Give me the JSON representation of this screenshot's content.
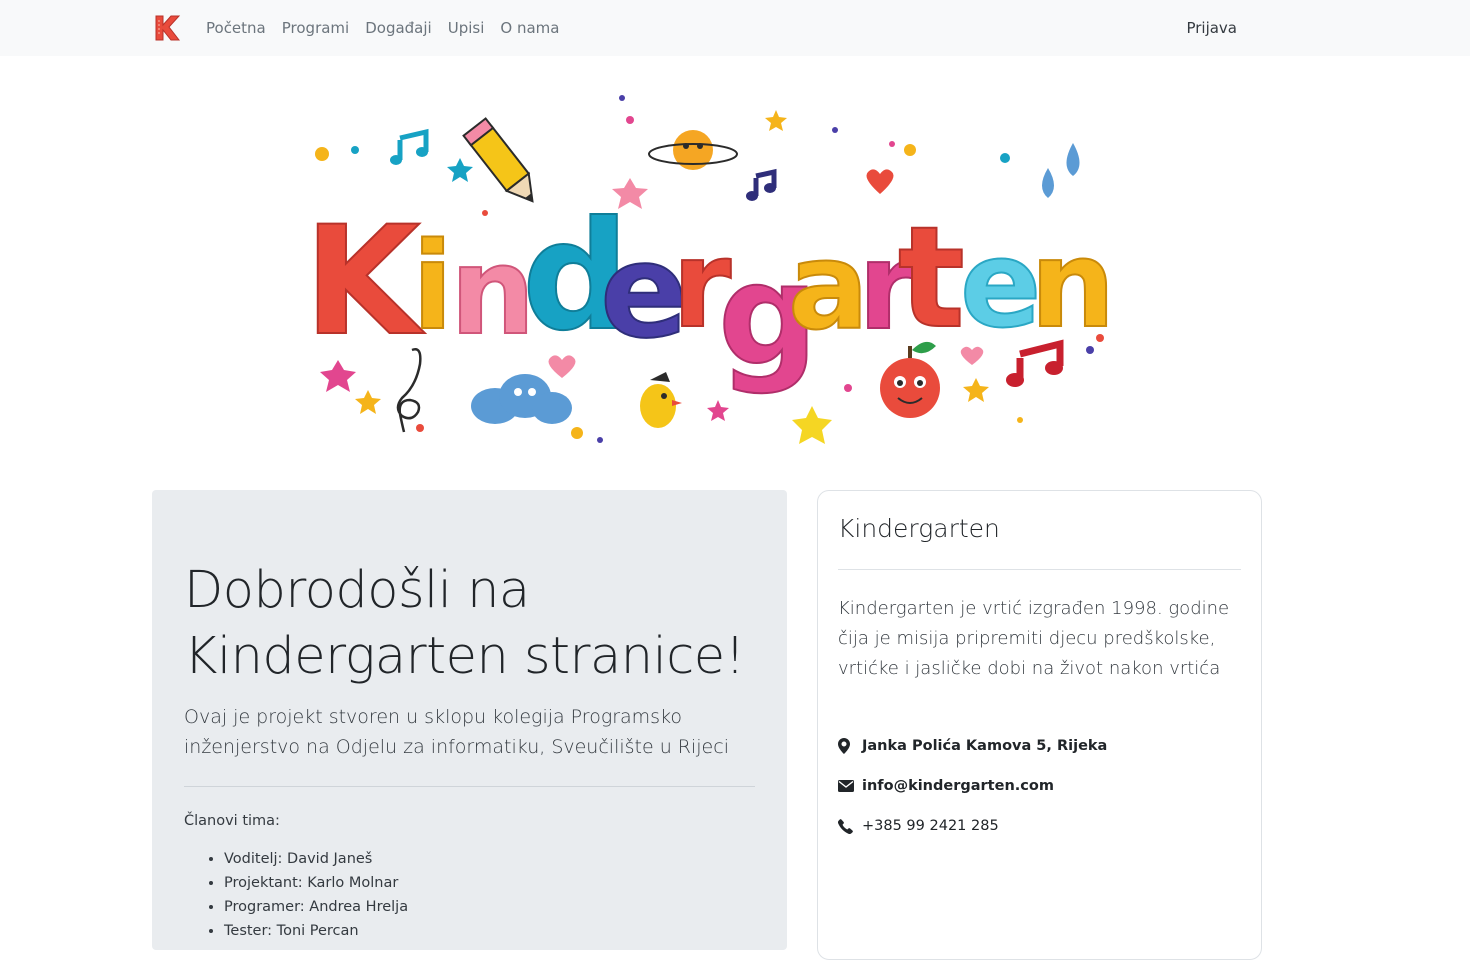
{
  "navbar": {
    "brand_icon": "kindergarten-k-logo-icon",
    "brand_letter": "K",
    "brand_color": "#e94b3c",
    "links": [
      "Početna",
      "Programi",
      "Događaji",
      "Upisi",
      "O nama"
    ],
    "login_label": "Prijava"
  },
  "hero": {
    "image_text": "Kindergarten",
    "letter_colors": [
      "#e94b3c",
      "#f5b41a",
      "#e2468f",
      "#17a2c4",
      "#4a3fa8",
      "#e94b3c",
      "#f5b41a",
      "#e2468f",
      "#e94b3c",
      "#5ccde6",
      "#f5b41a"
    ]
  },
  "jumbotron": {
    "title": "Dobrodošli na Kindergarten stranice!",
    "lead": "Ovaj je projekt stvoren u sklopu kolegija Programsko inženjerstvo na Odjelu za informatiku, Sveučilište u Rijeci",
    "team_title": "Članovi tima:",
    "team_members": [
      "Voditelj: David Janeš",
      "Projektant: Karlo Molnar",
      "Programer: Andrea Hrelja",
      "Tester: Toni Percan"
    ]
  },
  "card": {
    "title": "Kindergarten",
    "text": "Kindergarten je vrtić izgrađen 1998. godine čija je misija pripremiti djecu predškolske, vrtićke i jasličke dobi na život nakon vrtića",
    "contacts": {
      "address": {
        "icon": "map-marker-icon",
        "text": "Janka Polića Kamova 5, Rijeka"
      },
      "email": {
        "icon": "envelope-icon",
        "text": "info@kindergarten.com"
      },
      "phone": {
        "icon": "phone-icon",
        "text": "+385 99 2421 285"
      }
    }
  }
}
